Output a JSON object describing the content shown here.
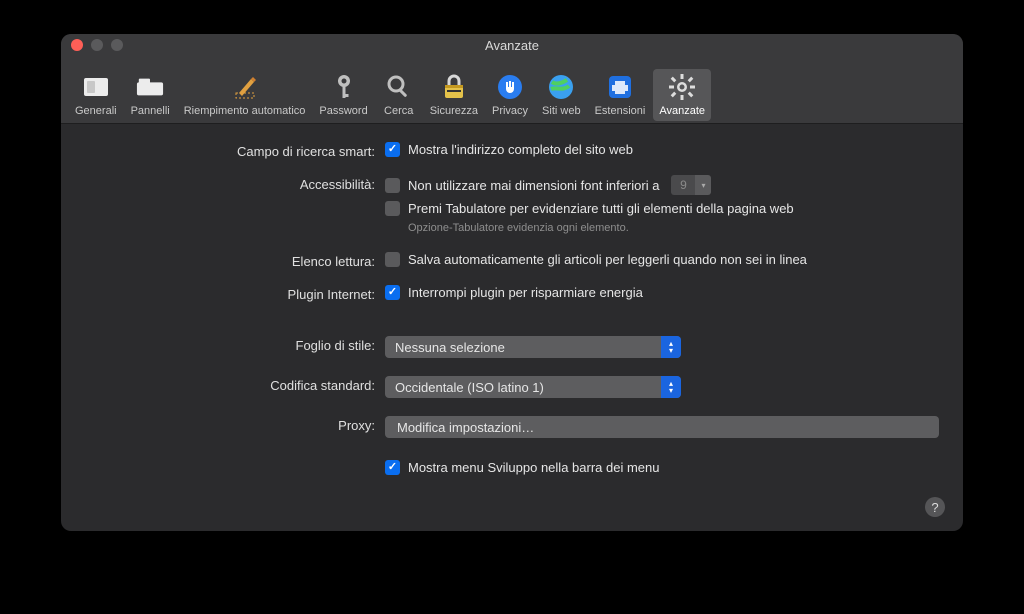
{
  "window": {
    "title": "Avanzate"
  },
  "toolbar": {
    "tabs": [
      {
        "label": "Generali"
      },
      {
        "label": "Pannelli"
      },
      {
        "label": "Riempimento automatico"
      },
      {
        "label": "Password"
      },
      {
        "label": "Cerca"
      },
      {
        "label": "Sicurezza"
      },
      {
        "label": "Privacy"
      },
      {
        "label": "Siti web"
      },
      {
        "label": "Estensioni"
      },
      {
        "label": "Avanzate"
      }
    ]
  },
  "labels": {
    "smart_search": "Campo di ricerca smart:",
    "accessibility": "Accessibilità:",
    "reading_list": "Elenco lettura:",
    "internet_plugin": "Plugin Internet:",
    "stylesheet": "Foglio di stile:",
    "encoding": "Codifica standard:",
    "proxy": "Proxy:"
  },
  "opts": {
    "show_full_address": "Mostra l'indirizzo completo del sito web",
    "never_font_smaller": "Non utilizzare mai dimensioni font inferiori a",
    "min_font_value": "9",
    "tab_highlights": "Premi Tabulatore per evidenziare tutti gli elementi della pagina web",
    "tab_hint": "Opzione-Tabulatore evidenzia ogni elemento.",
    "save_offline": "Salva automaticamente gli articoli per leggerli quando non sei in linea",
    "stop_plugins": "Interrompi plugin per risparmiare energia",
    "stylesheet_value": "Nessuna selezione",
    "encoding_value": "Occidentale (ISO latino 1)",
    "proxy_button": "Modifica impostazioni…",
    "show_develop": "Mostra menu Sviluppo nella barra dei menu"
  }
}
